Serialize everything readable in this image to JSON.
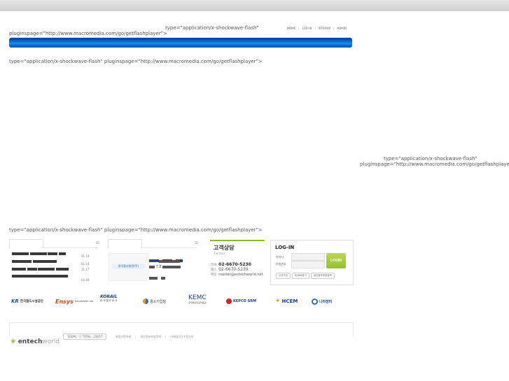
{
  "flash": {
    "type_attr": "type=\"application/x-shockwave-flash\"",
    "plugin_attr": "pluginspage=\"http://www.macromedia.com/go/getflashplayer\">",
    "full_line": "type=\"application/x-shockwave-flash\" pluginspage=\"http://www.macromedia.com/go/getflashplayer\">"
  },
  "util_menu": [
    "HOME",
    "LOG-IN",
    "SITEMAP",
    "ADMIN"
  ],
  "news": {
    "dates": [
      "01.14",
      "01.14",
      "11.17",
      "04.28"
    ]
  },
  "banner": {
    "label": "한국중부발전(주)",
    "year_text": "2009",
    "date_text": "7.8"
  },
  "contact": {
    "title": "고객상담",
    "subtitle": "Contact",
    "phone_label": "전화",
    "phone": "02-6670-5230",
    "fax_label": "팩스",
    "fax": "02-6670-5239",
    "email_label": "메일",
    "email": "master@entechworld.net"
  },
  "login": {
    "title": "LOG-IN",
    "id_label": "아이디",
    "pw_label": "비밀번호",
    "button": "LOGIN",
    "links": [
      "신규가입",
      "ID/PW찾기",
      "개인정보보호정책"
    ]
  },
  "logos": {
    "kr": "한국철도시설공단",
    "ensys": "Ensys",
    "ensys_sub": "Conversion ink",
    "korail": "KORAIL",
    "korail_sub": "한국철도공사",
    "sme": "중소기업청",
    "kemc": "KEMC",
    "kemc_sub": "한국에너지관리공단",
    "kepco": "KEPCO SRM",
    "hcem": "HCEM",
    "nara": "나라장터"
  },
  "footer": {
    "counter": "TODAY : 1   TOTAL : 22057",
    "links": [
      "회원이용약관",
      "개인정보보호정책",
      "이메일무단수집거부"
    ],
    "logo_main": "entech",
    "logo_light": "world"
  },
  "colors": {
    "blue_bar": "#0b76d8",
    "login_green": "#94c12d",
    "contact_accent": "#8cb63c"
  }
}
